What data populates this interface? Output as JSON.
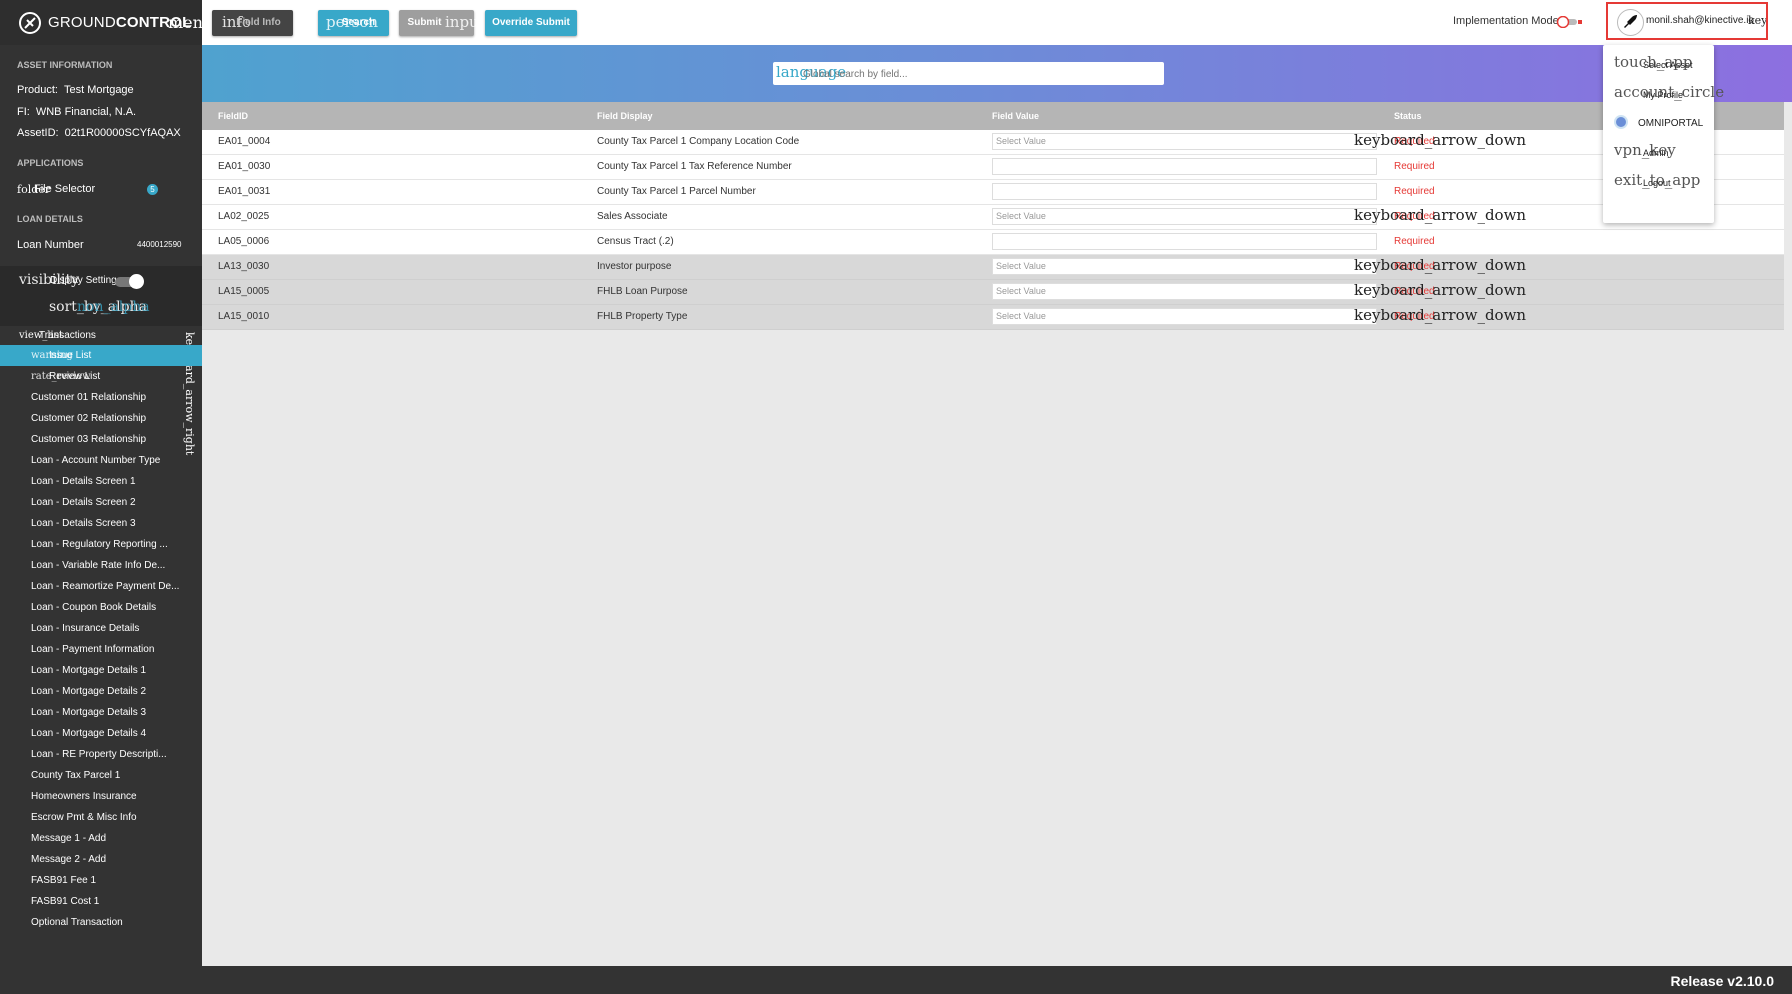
{
  "brand": {
    "name_light": "GROUND",
    "name_bold": "CONTROL",
    "menu_glyph": "menu"
  },
  "sidebar": {
    "asset_info_heading": "ASSET INFORMATION",
    "product": {
      "label": "Product:",
      "value": "Test Mortgage"
    },
    "fi": {
      "label": "FI:",
      "value": "WNB Financial, N.A."
    },
    "asset_id": {
      "label": "AssetID:",
      "value": "02t1R00000SCYfAQAX"
    },
    "applications_heading": "APPLICATIONS",
    "file_selector": {
      "glyph": "folder",
      "label": "File Selector",
      "count": "5"
    },
    "loan_details_heading": "LOAN DETAILS",
    "loan_number": {
      "label": "Loan Number",
      "value": "4400012590"
    },
    "display_settings": {
      "glyph": "visibility",
      "label": "Display Settings"
    },
    "sort_glyph": "sort_by_alpha",
    "sort_overlap": "non_alpha",
    "transactions": {
      "glyph": "view_list",
      "label": "Transactions",
      "arrow": "keyboard_arrow_right"
    },
    "items": [
      {
        "glyph": "warning",
        "label": "Issue List",
        "active": true
      },
      {
        "glyph": "rate_review",
        "label": "Review List",
        "active": false
      },
      {
        "label": "Customer 01 Relationship"
      },
      {
        "label": "Customer 02 Relationship"
      },
      {
        "label": "Customer 03 Relationship"
      },
      {
        "label": "Loan - Account Number Type"
      },
      {
        "label": "Loan - Details Screen 1"
      },
      {
        "label": "Loan - Details Screen 2"
      },
      {
        "label": "Loan - Details Screen 3"
      },
      {
        "label": "Loan - Regulatory Reporting ..."
      },
      {
        "label": "Loan - Variable Rate Info De..."
      },
      {
        "label": "Loan - Reamortize Payment De..."
      },
      {
        "label": "Loan - Coupon Book Details"
      },
      {
        "label": "Loan - Insurance Details"
      },
      {
        "label": "Loan - Payment Information"
      },
      {
        "label": "Loan - Mortgage Details 1"
      },
      {
        "label": "Loan - Mortgage Details 2"
      },
      {
        "label": "Loan - Mortgage Details 3"
      },
      {
        "label": "Loan - Mortgage Details 4"
      },
      {
        "label": "Loan - RE Property Descripti..."
      },
      {
        "label": "County Tax Parcel 1"
      },
      {
        "label": "Homeowners Insurance"
      },
      {
        "label": "Escrow Pmt & Misc Info"
      },
      {
        "label": "Message 1 - Add"
      },
      {
        "label": "Message 2 - Add"
      },
      {
        "label": "FASB91 Fee 1"
      },
      {
        "label": "FASB91 Cost 1"
      },
      {
        "label": "Optional Transaction"
      }
    ]
  },
  "toolbar": {
    "field_info": {
      "glyph": "info",
      "label": "Field Info"
    },
    "search": {
      "glyph": "person",
      "label": "Search"
    },
    "submit": {
      "glyph": "input",
      "label": "Submit"
    },
    "override_submit": {
      "label": "Override Submit"
    },
    "impl_mode_label": "Implementation Mode",
    "user_email": "monil.shah@kinective.io",
    "user_menu_glyph": "keyboard_arrow_down"
  },
  "search": {
    "glyph": "language",
    "placeholder": "Global search by field..."
  },
  "table": {
    "headers": {
      "field_id": "FieldID",
      "field_display": "Field Display",
      "field_value": "Field Value",
      "status": "Status"
    },
    "dropdown_glyph": "keyboard_arrow_down",
    "select_placeholder": "Select Value",
    "rows": [
      {
        "id": "EA01_0004",
        "display": "County Tax Parcel 1 Company Location Code",
        "type": "select",
        "status": "Required"
      },
      {
        "id": "EA01_0030",
        "display": "County Tax Parcel 1 Tax Reference Number",
        "type": "text",
        "status": "Required"
      },
      {
        "id": "EA01_0031",
        "display": "County Tax Parcel 1 Parcel Number",
        "type": "text",
        "status": "Required"
      },
      {
        "id": "LA02_0025",
        "display": "Sales Associate",
        "type": "select",
        "status": "Required"
      },
      {
        "id": "LA05_0006",
        "display": "Census Tract (.2)",
        "type": "text",
        "status": "Required"
      },
      {
        "id": "LA13_0030",
        "display": "Investor purpose",
        "type": "select",
        "status": "Required"
      },
      {
        "id": "LA15_0005",
        "display": "FHLB Loan Purpose",
        "type": "select",
        "status": "Required"
      },
      {
        "id": "LA15_0010",
        "display": "FHLB Property Type",
        "type": "select",
        "status": "Required"
      }
    ]
  },
  "user_menu": {
    "items": [
      {
        "glyph": "touch_app",
        "label": "Select Asset"
      },
      {
        "glyph": "account_circle",
        "label": "My Profile"
      },
      {
        "glyph": "",
        "label": "OMNIPORTAL"
      },
      {
        "glyph": "vpn_key",
        "label": "Admin"
      },
      {
        "glyph": "exit_to_app",
        "label": "Logout"
      }
    ]
  },
  "footer": {
    "release": "Release v2.10.0"
  },
  "colors": {
    "accent": "#38a8c9",
    "sidebar": "#333333",
    "required": "#e53935",
    "highlight_border": "#e53935"
  }
}
